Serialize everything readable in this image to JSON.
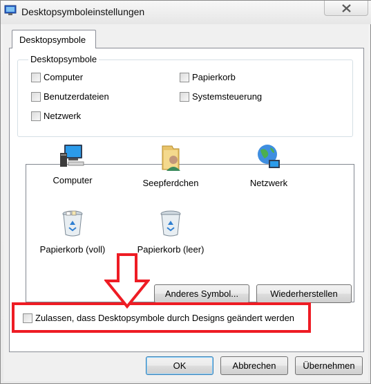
{
  "window": {
    "title": "Desktopsymboleinstellungen",
    "close_icon": "close-icon"
  },
  "tabs": [
    {
      "label": "Desktopsymbole",
      "selected": true
    }
  ],
  "desktop_icons_group": {
    "label": "Desktopsymbole",
    "checkboxes": [
      {
        "label": "Computer",
        "checked": false
      },
      {
        "label": "Papierkorb",
        "checked": false
      },
      {
        "label": "Benutzerdateien",
        "checked": false
      },
      {
        "label": "Systemsteuerung",
        "checked": false
      },
      {
        "label": "Netzwerk",
        "checked": false
      }
    ]
  },
  "icon_list": [
    {
      "label": "Computer",
      "icon": "computer-icon"
    },
    {
      "label": "Seepferdchen",
      "icon": "user-folder-icon"
    },
    {
      "label": "Netzwerk",
      "icon": "network-icon"
    },
    {
      "label": "Papierkorb (voll)",
      "icon": "recycle-bin-full-icon"
    },
    {
      "label": "Papierkorb (leer)",
      "icon": "recycle-bin-empty-icon"
    }
  ],
  "icon_actions": {
    "change_icon": "Anderes Symbol...",
    "restore": "Wiederherstellen"
  },
  "allow_themes": {
    "label": "Zulassen, dass Desktopsymbole durch Designs geändert werden",
    "checked": false
  },
  "dialog_buttons": {
    "ok": "OK",
    "cancel": "Abbrechen",
    "apply": "Übernehmen"
  },
  "colors": {
    "highlight": "#ee1c24",
    "default_button_border": "#3c7fb1"
  }
}
